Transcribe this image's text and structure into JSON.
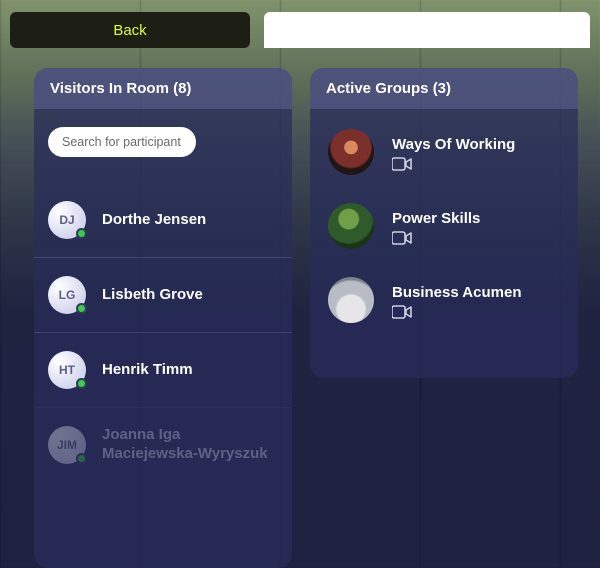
{
  "topbar": {
    "back_label": "Back"
  },
  "visitors_panel": {
    "header": "Visitors In Room (8)",
    "search_placeholder": "Search for participant",
    "items": [
      {
        "initials": "DJ",
        "name": "Dorthe Jensen",
        "online": true,
        "faded": false
      },
      {
        "initials": "LG",
        "name": "Lisbeth Grove",
        "online": true,
        "faded": false
      },
      {
        "initials": "HT",
        "name": "Henrik Timm",
        "online": true,
        "faded": false
      },
      {
        "initials": "JIM",
        "name": "Joanna Iga Maciejewska-Wyryszuk",
        "online": true,
        "faded": true
      }
    ]
  },
  "groups_panel": {
    "header": "Active Groups (3)",
    "items": [
      {
        "title": "Ways Of Working",
        "thumb": "thumb-1"
      },
      {
        "title": "Power Skills",
        "thumb": "thumb-2"
      },
      {
        "title": "Business Acumen",
        "thumb": "thumb-3"
      }
    ]
  },
  "colors": {
    "accent_yellow": "#d7ff3a",
    "online_green": "#3fcc4a",
    "panel_bg": "rgba(40,45,90,0.72)"
  }
}
